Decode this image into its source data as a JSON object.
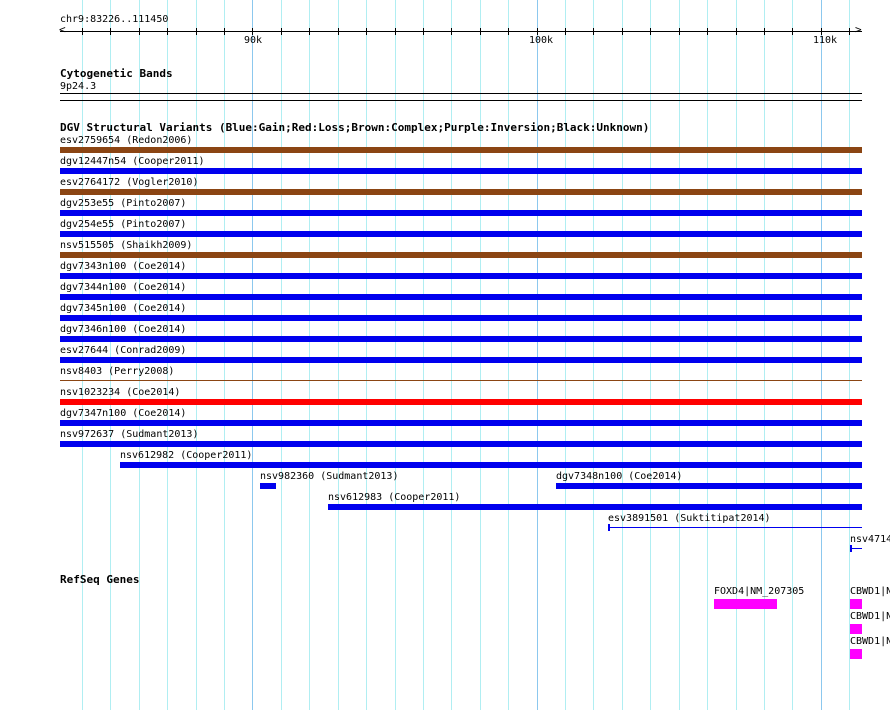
{
  "ruler": {
    "location": "chr9:83226..111450",
    "start": 83226,
    "end": 111450,
    "labels": [
      {
        "bp": 90000,
        "text": "90k"
      },
      {
        "bp": 100000,
        "text": "100k"
      },
      {
        "bp": 110000,
        "text": "110k"
      }
    ]
  },
  "cyto": {
    "title": "Cytogenetic Bands",
    "band": "9p24.3"
  },
  "dgv": {
    "title": "DGV Structural Variants (Blue:Gain;Red:Loss;Brown:Complex;Purple:Inversion;Black:Unknown)",
    "colors": {
      "gain": "#0000ee",
      "loss": "#ff0000",
      "complex": "#8b4513"
    },
    "features": [
      {
        "label": "esv2759654 (Redon2006)",
        "type": "complex",
        "start": 83226,
        "end": 111450,
        "row": 0
      },
      {
        "label": "dgv12447n54 (Cooper2011)",
        "type": "gain",
        "start": 83226,
        "end": 111450,
        "row": 1
      },
      {
        "label": "esv2764172 (Vogler2010)",
        "type": "complex",
        "start": 83226,
        "end": 111450,
        "row": 2
      },
      {
        "label": "dgv253e55 (Pinto2007)",
        "type": "gain",
        "start": 83226,
        "end": 111450,
        "row": 3
      },
      {
        "label": "dgv254e55 (Pinto2007)",
        "type": "gain",
        "start": 83226,
        "end": 111450,
        "row": 4
      },
      {
        "label": "nsv515505 (Shaikh2009)",
        "type": "complex",
        "start": 83226,
        "end": 111450,
        "row": 5
      },
      {
        "label": "dgv7343n100 (Coe2014)",
        "type": "gain",
        "start": 83226,
        "end": 111450,
        "row": 6
      },
      {
        "label": "dgv7344n100 (Coe2014)",
        "type": "gain",
        "start": 83226,
        "end": 111450,
        "row": 7
      },
      {
        "label": "dgv7345n100 (Coe2014)",
        "type": "gain",
        "start": 83226,
        "end": 111450,
        "row": 8
      },
      {
        "label": "dgv7346n100 (Coe2014)",
        "type": "gain",
        "start": 83226,
        "end": 111450,
        "row": 9
      },
      {
        "label": "esv27644 (Conrad2009)",
        "type": "gain",
        "start": 83226,
        "end": 111450,
        "row": 10
      },
      {
        "label": "nsv8403 (Perry2008)",
        "type": "complex",
        "start": 83226,
        "end": 111450,
        "row": 11,
        "thin": true
      },
      {
        "label": "nsv1023234 (Coe2014)",
        "type": "loss",
        "start": 83226,
        "end": 111450,
        "row": 12
      },
      {
        "label": "dgv7347n100 (Coe2014)",
        "type": "gain",
        "start": 83226,
        "end": 111450,
        "row": 13
      },
      {
        "label": "nsv972637 (Sudmant2013)",
        "type": "gain",
        "start": 83226,
        "end": 111450,
        "row": 14
      },
      {
        "label": "nsv612982 (Cooper2011)",
        "type": "gain",
        "start": 85342,
        "end": 111450,
        "row": 15
      },
      {
        "label": "nsv982360 (Sudmant2013)",
        "type": "gain",
        "start": 90281,
        "end": 90810,
        "row": 16
      },
      {
        "label": "dgv7348n100 (Coe2014)",
        "type": "gain",
        "start": 100686,
        "end": 111450,
        "row": 16
      },
      {
        "label": "nsv612983 (Cooper2011)",
        "type": "gain",
        "start": 92644,
        "end": 111450,
        "row": 17
      },
      {
        "label": "esv3891501 (Suktitipat2014)",
        "type": "gain",
        "start": 102520,
        "end": 111450,
        "row": 18,
        "line": true
      },
      {
        "label": "nsv4714",
        "type": "gain",
        "start": 111022,
        "end": 111450,
        "row": 19,
        "line": true
      }
    ]
  },
  "refseq": {
    "title": "RefSeq Genes",
    "color": "#ff00ff",
    "genes": [
      {
        "label": "FOXD4|NM_207305",
        "start": 106225,
        "end": 108446,
        "row": 0
      },
      {
        "label": "CBWD1|N",
        "start": 111022,
        "end": 111450,
        "row": 0
      },
      {
        "label": "CBWD1|N",
        "start": 111022,
        "end": 111450,
        "row": 1
      },
      {
        "label": "CBWD1|N",
        "start": 111022,
        "end": 111450,
        "row": 2
      }
    ]
  }
}
